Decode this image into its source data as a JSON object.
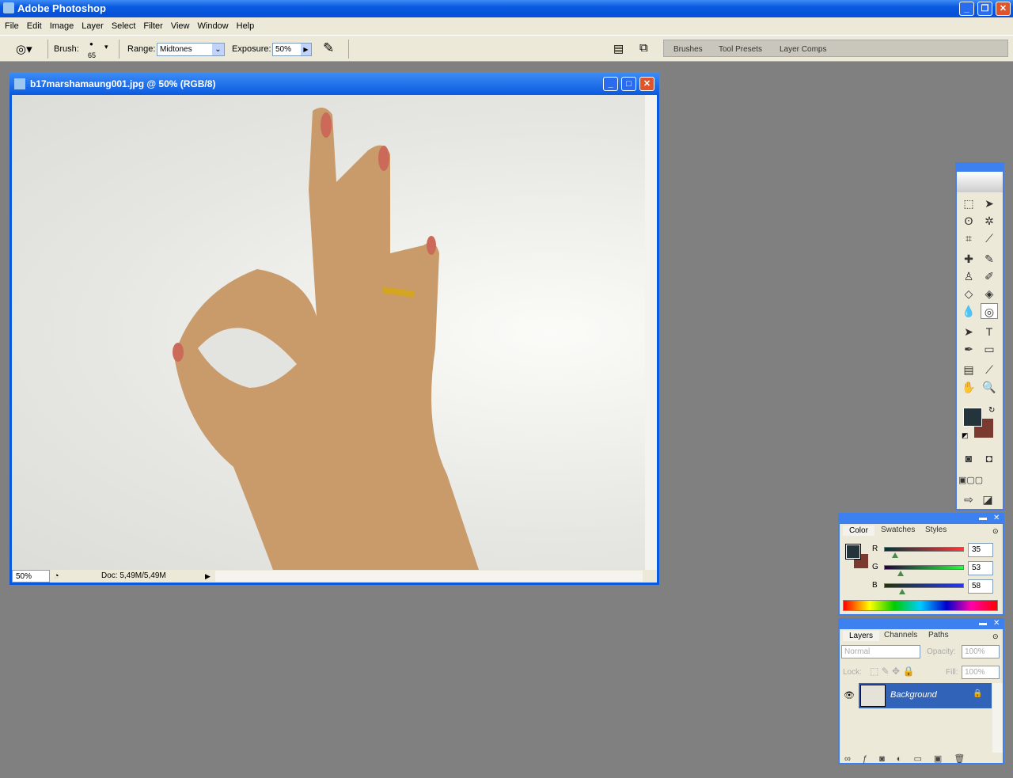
{
  "app": {
    "title": "Adobe Photoshop"
  },
  "menu": [
    "File",
    "Edit",
    "Image",
    "Layer",
    "Select",
    "Filter",
    "View",
    "Window",
    "Help"
  ],
  "options": {
    "brush_label": "Brush:",
    "brush_size": "65",
    "range_label": "Range:",
    "range_value": "Midtones",
    "exposure_label": "Exposure:",
    "exposure_value": "50%"
  },
  "well_tabs": [
    "Brushes",
    "Tool Presets",
    "Layer Comps"
  ],
  "document": {
    "title": "b17marshamaung001.jpg @ 50% (RGB/8)",
    "zoom": "50%",
    "doc_info": "Doc: 5,49M/5,49M"
  },
  "colors": {
    "foreground": "#23353a",
    "background": "#7a3a30"
  },
  "color_panel": {
    "tabs": [
      "Color",
      "Swatches",
      "Styles"
    ],
    "channels": [
      {
        "label": "R",
        "value": "35"
      },
      {
        "label": "G",
        "value": "53"
      },
      {
        "label": "B",
        "value": "58"
      }
    ]
  },
  "layers_panel": {
    "tabs": [
      "Layers",
      "Channels",
      "Paths"
    ],
    "blend_mode": "Normal",
    "opacity_label": "Opacity:",
    "opacity": "100%",
    "lock_label": "Lock:",
    "fill_label": "Fill:",
    "fill": "100%",
    "layers": [
      {
        "name": "Background",
        "visible": true,
        "locked": true
      }
    ]
  }
}
